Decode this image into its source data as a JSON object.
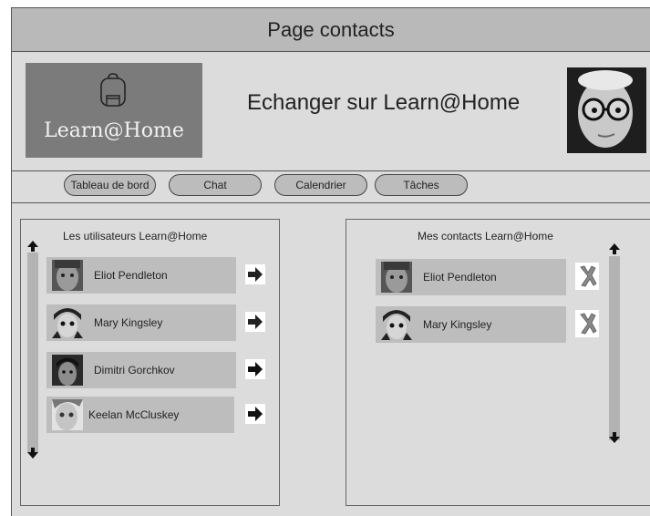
{
  "page_title": "Page contacts",
  "header": {
    "logo_text": "Learn@Home",
    "title": "Echanger sur Learn@Home"
  },
  "nav": {
    "items": [
      {
        "label": "Tableau de bord"
      },
      {
        "label": "Chat"
      },
      {
        "label": "Calendrier"
      },
      {
        "label": "Tâches"
      }
    ]
  },
  "users_panel": {
    "title": "Les utilisateurs Learn@Home",
    "users": [
      {
        "name": "Eliot Pendleton"
      },
      {
        "name": "Mary Kingsley"
      },
      {
        "name": "Dimitri Gorchkov"
      },
      {
        "name": "Keelan McCluskey"
      }
    ]
  },
  "contacts_panel": {
    "title": "Mes contacts Learn@Home",
    "contacts": [
      {
        "name": "Eliot Pendleton"
      },
      {
        "name": "Mary Kingsley"
      }
    ]
  },
  "icons": {
    "logo": "backpack-icon",
    "add": "arrow-right-icon",
    "remove": "x-icon",
    "scroll_up": "arrow-up-icon",
    "scroll_down": "arrow-down-icon"
  },
  "colors": {
    "background": "#dcdcdc",
    "title_bar": "#b9b9b9",
    "logo_box": "#7b7b7b",
    "row": "#bdbdbd"
  }
}
